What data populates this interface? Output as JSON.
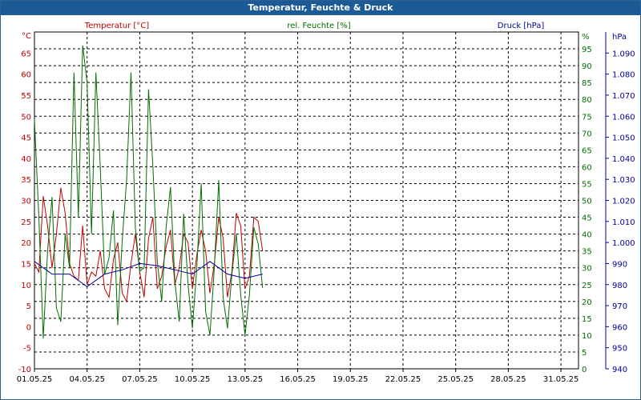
{
  "window": {
    "title": "Temperatur, Feuchte & Druck"
  },
  "colors": {
    "title_bar": "#1c5a96",
    "temperature": "#c00000",
    "humidity": "#007000",
    "pressure": "#00009c",
    "grid": "#000000"
  },
  "chart_data": {
    "type": "line",
    "grid": true,
    "legend": [
      {
        "label": "Temperatur [°C]",
        "color": "#c00000",
        "position": "top-left"
      },
      {
        "label": "rel. Feuchte [%]",
        "color": "#007000",
        "position": "top-center"
      },
      {
        "label": "Druck [hPa]",
        "color": "#00009c",
        "position": "top-right"
      }
    ],
    "x_axis": {
      "type": "date",
      "range": [
        "01.05.25",
        "01.06.25"
      ],
      "tick_labels": [
        "01.05.25",
        "04.05.25",
        "07.05.25",
        "10.05.25",
        "13.05.25",
        "16.05.25",
        "19.05.25",
        "22.05.25",
        "25.05.25",
        "28.05.25",
        "31.05.25"
      ]
    },
    "y_axes": [
      {
        "id": "temperature",
        "side": "left",
        "unit": "°C",
        "range": [
          -10,
          70
        ],
        "tick_labels": [
          "-10",
          "-5",
          "0",
          "5",
          "10",
          "15",
          "20",
          "25",
          "30",
          "35",
          "40",
          "45",
          "50",
          "55",
          "60",
          "65"
        ]
      },
      {
        "id": "humidity",
        "side": "right",
        "unit": "%",
        "range": [
          0,
          100
        ],
        "tick_labels": [
          "0",
          "5",
          "10",
          "15",
          "20",
          "25",
          "30",
          "35",
          "40",
          "45",
          "50",
          "55",
          "60",
          "65",
          "70",
          "75",
          "80",
          "85",
          "90",
          "95"
        ]
      },
      {
        "id": "pressure",
        "side": "right",
        "unit": "hPa",
        "range": [
          940,
          1100
        ],
        "tick_labels": [
          "940",
          "950",
          "960",
          "970",
          "980",
          "990",
          "1.000",
          "1.010",
          "1.020",
          "1.030",
          "1.040",
          "1.050",
          "1.060",
          "1.070",
          "1.080",
          "1.090"
        ]
      }
    ],
    "series": [
      {
        "name": "Temperatur [°C]",
        "axis": "temperature",
        "x": [
          "01.05.25 00:00",
          "01.05.25 06:00",
          "01.05.25 12:00",
          "01.05.25 18:00",
          "02.05.25 00:00",
          "02.05.25 06:00",
          "02.05.25 12:00",
          "02.05.25 18:00",
          "03.05.25 00:00",
          "03.05.25 06:00",
          "03.05.25 12:00",
          "03.05.25 18:00",
          "04.05.25 00:00",
          "04.05.25 06:00",
          "04.05.25 12:00",
          "04.05.25 18:00",
          "05.05.25 00:00",
          "05.05.25 06:00",
          "05.05.25 12:00",
          "05.05.25 18:00",
          "06.05.25 00:00",
          "06.05.25 06:00",
          "06.05.25 12:00",
          "06.05.25 18:00",
          "07.05.25 00:00",
          "07.05.25 06:00",
          "07.05.25 12:00",
          "07.05.25 18:00",
          "08.05.25 00:00",
          "08.05.25 06:00",
          "08.05.25 12:00",
          "08.05.25 18:00",
          "09.05.25 00:00",
          "09.05.25 06:00",
          "09.05.25 12:00",
          "09.05.25 18:00",
          "10.05.25 00:00",
          "10.05.25 06:00",
          "10.05.25 12:00",
          "10.05.25 18:00",
          "11.05.25 00:00",
          "11.05.25 06:00",
          "11.05.25 12:00",
          "11.05.25 18:00",
          "12.05.25 00:00",
          "12.05.25 06:00",
          "12.05.25 12:00",
          "12.05.25 18:00",
          "13.05.25 00:00",
          "13.05.25 06:00",
          "13.05.25 12:00",
          "13.05.25 18:00",
          "14.05.25 00:00"
        ],
        "values": [
          15,
          13,
          31,
          24,
          14,
          22,
          33,
          27,
          15,
          12,
          11,
          24,
          10,
          13,
          12,
          18,
          9,
          7,
          16,
          20,
          8,
          6,
          15,
          22,
          13,
          7,
          21,
          26,
          9,
          12,
          19,
          23,
          10,
          14,
          22,
          20,
          9,
          17,
          23,
          18,
          8,
          15,
          26,
          21,
          7,
          13,
          27,
          24,
          9,
          12,
          26,
          25,
          18
        ]
      },
      {
        "name": "rel. Feuchte [%]",
        "axis": "humidity",
        "x": [
          "01.05.25 00:00",
          "01.05.25 06:00",
          "01.05.25 12:00",
          "01.05.25 18:00",
          "02.05.25 00:00",
          "02.05.25 06:00",
          "02.05.25 12:00",
          "02.05.25 18:00",
          "03.05.25 00:00",
          "03.05.25 06:00",
          "03.05.25 12:00",
          "03.05.25 18:00",
          "04.05.25 00:00",
          "04.05.25 06:00",
          "04.05.25 12:00",
          "04.05.25 18:00",
          "05.05.25 00:00",
          "05.05.25 06:00",
          "05.05.25 12:00",
          "05.05.25 18:00",
          "06.05.25 00:00",
          "06.05.25 06:00",
          "06.05.25 12:00",
          "06.05.25 18:00",
          "07.05.25 00:00",
          "07.05.25 06:00",
          "07.05.25 12:00",
          "07.05.25 18:00",
          "08.05.25 00:00",
          "08.05.25 06:00",
          "08.05.25 12:00",
          "08.05.25 18:00",
          "09.05.25 00:00",
          "09.05.25 06:00",
          "09.05.25 12:00",
          "09.05.25 18:00",
          "10.05.25 00:00",
          "10.05.25 06:00",
          "10.05.25 12:00",
          "10.05.25 18:00",
          "11.05.25 00:00",
          "11.05.25 06:00",
          "11.05.25 12:00",
          "11.05.25 18:00",
          "12.05.25 00:00",
          "12.05.25 06:00",
          "12.05.25 12:00",
          "12.05.25 18:00",
          "13.05.25 00:00",
          "13.05.25 06:00",
          "13.05.25 12:00",
          "13.05.25 18:00",
          "14.05.25 00:00"
        ],
        "values": [
          74,
          45,
          9,
          35,
          51,
          18,
          14,
          40,
          30,
          88,
          45,
          96,
          85,
          40,
          88,
          60,
          28,
          33,
          47,
          13,
          38,
          56,
          88,
          42,
          29,
          30,
          83,
          60,
          32,
          20,
          42,
          54,
          26,
          14,
          46,
          25,
          12,
          30,
          55,
          17,
          10,
          30,
          56,
          21,
          12,
          28,
          40,
          22,
          10,
          22,
          42,
          37,
          24
        ]
      },
      {
        "name": "Druck [hPa]",
        "axis": "pressure",
        "x": [
          "01.05.25",
          "02.05.25",
          "03.05.25",
          "04.05.25",
          "05.05.25",
          "06.05.25",
          "07.05.25",
          "08.05.25",
          "09.05.25",
          "10.05.25",
          "11.05.25",
          "12.05.25",
          "13.05.25",
          "14.05.25"
        ],
        "values": [
          991,
          985,
          985,
          979,
          985,
          987,
          990,
          989,
          987,
          985,
          991,
          985,
          983,
          985
        ]
      }
    ]
  }
}
